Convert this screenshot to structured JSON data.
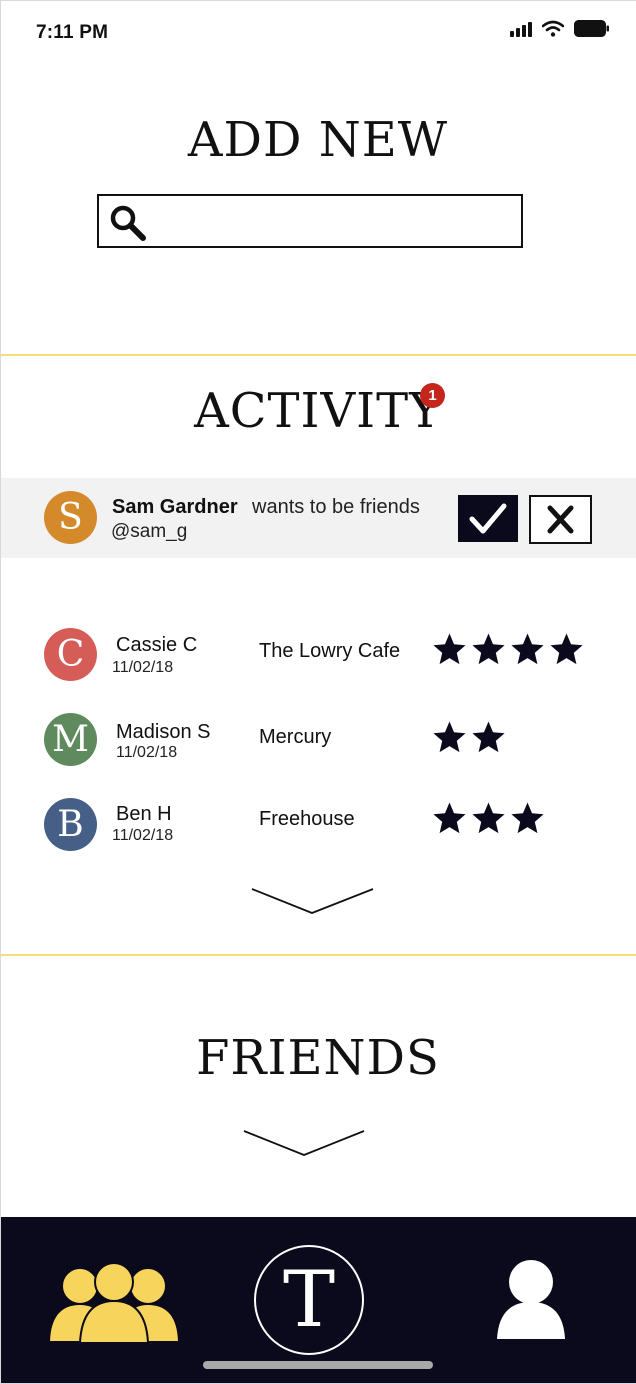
{
  "status": {
    "time": "7:11 PM"
  },
  "add_new": {
    "title": "ADD NEW",
    "search": {
      "value": "",
      "placeholder": ""
    }
  },
  "activity": {
    "title": "ACTIVITY",
    "badge": "1",
    "request": {
      "initial": "S",
      "avatar_color": "#d4892b",
      "name": "Sam Gardner",
      "handle": "@sam_g",
      "text": "wants to be friends"
    },
    "rows": [
      {
        "initial": "C",
        "avatar_color": "#d65c58",
        "name": "Cassie C",
        "date": "11/02/18",
        "place": "The Lowry Cafe",
        "stars": 4
      },
      {
        "initial": "M",
        "avatar_color": "#5f8a5e",
        "name": "Madison S",
        "date": "11/02/18",
        "place": "Mercury",
        "stars": 2
      },
      {
        "initial": "B",
        "avatar_color": "#465f86",
        "name": "Ben H",
        "date": "11/02/18",
        "place": "Freehouse",
        "stars": 3
      }
    ]
  },
  "friends": {
    "title": "FRIENDS"
  },
  "nav": {
    "home_letter": "T",
    "friends_icon": "friends-icon",
    "profile_icon": "profile-icon",
    "active_color": "#f7d55c"
  },
  "colors": {
    "navbar": "#0b0a1c",
    "divider": "#f5de7a",
    "badge": "#c4261d"
  }
}
